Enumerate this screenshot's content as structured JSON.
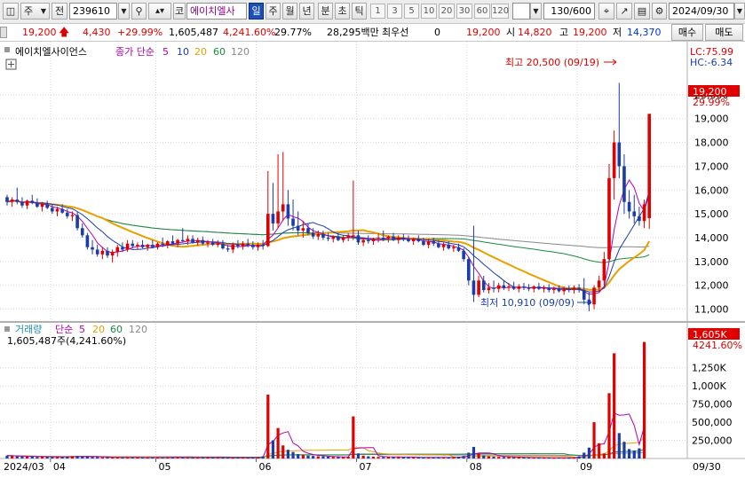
{
  "toolbar": {
    "market_select": "주",
    "prefix_label": "전",
    "code": "239610",
    "market_label": "코",
    "name": "에이치엘사",
    "periods": [
      "일",
      "주",
      "월",
      "년",
      "분",
      "초",
      "틱"
    ],
    "active_period": "일",
    "numbers": [
      "1",
      "3",
      "5",
      "10",
      "20",
      "30",
      "60",
      "120"
    ],
    "count": "130/600",
    "date": "2024/09/30"
  },
  "quote": {
    "price": "19,200",
    "change": "4,430",
    "change_pct": "+29.99%",
    "volume": "1,605,487",
    "volume_ratio": "4,241.60%",
    "turnover": "29.77%",
    "amount": "28,295백만",
    "pref_label": "최우선",
    "pref_value": "0",
    "ask": "19,200",
    "open_label": "시",
    "open": "14,820",
    "high_label": "고",
    "high": "19,200",
    "low_label": "저",
    "low": "14,370",
    "buy_button": "매수",
    "sell_button": "매도"
  },
  "price_panel": {
    "name": "에이치엘사이언스",
    "ma_label": "종가 단순",
    "ma_periods": [
      "5",
      "10",
      "20",
      "60",
      "120"
    ],
    "ma_colors": [
      "#b000b0",
      "#1c3ca8",
      "#e8a000",
      "#1a8a3c",
      "#888888"
    ],
    "lc": "LC:75.99",
    "hc": "HC:-6.34",
    "current_tag": "19,200",
    "current_pct": "29.99%",
    "high_annotation": "최고 20,500 (09/19)",
    "low_annotation": "최저 10,910 (09/09)"
  },
  "volume_panel": {
    "label": "거래량",
    "ma_label": "단순",
    "ma_periods": [
      "5",
      "20",
      "60",
      "120"
    ],
    "volume_text": "1,605,487주(4,241.60%)",
    "current_tag": "1,605K",
    "current_pct": "4241.60%"
  },
  "x_labels": [
    "2024/03",
    "04",
    "05",
    "06",
    "07",
    "08",
    "09",
    "09/30"
  ],
  "chart_data": {
    "type": "candlestick",
    "title": "에이치엘사이언스",
    "price_ylim": [
      10500,
      21000
    ],
    "price_ticks": [
      11000,
      12000,
      13000,
      14000,
      15000,
      16000,
      17000,
      18000,
      19000,
      20000
    ],
    "volume_ticks": [
      250000,
      500000,
      750000,
      1000000,
      1250000
    ],
    "volume_tick_labels": [
      "250,000",
      "500,000",
      "750,000",
      "1,000K",
      "1,250K"
    ],
    "volume_ylim": [
      0,
      1650000
    ],
    "months": [
      {
        "label": "2024/03",
        "index": 0
      },
      {
        "label": "04",
        "index": 9
      },
      {
        "label": "05",
        "index": 30
      },
      {
        "label": "06",
        "index": 50
      },
      {
        "label": "07",
        "index": 70
      },
      {
        "label": "08",
        "index": 92
      },
      {
        "label": "09",
        "index": 114
      }
    ],
    "ohlc": [
      [
        15700,
        15800,
        15350,
        15500
      ],
      [
        15500,
        15700,
        15300,
        15600
      ],
      [
        15600,
        16100,
        15400,
        15500
      ],
      [
        15500,
        15700,
        15250,
        15350
      ],
      [
        15350,
        15600,
        15200,
        15550
      ],
      [
        15550,
        15800,
        15400,
        15450
      ],
      [
        15450,
        15650,
        15250,
        15300
      ],
      [
        15300,
        15500,
        15100,
        15400
      ],
      [
        15400,
        15550,
        15200,
        15250
      ],
      [
        15250,
        15400,
        15000,
        15100
      ],
      [
        15100,
        15300,
        14900,
        15200
      ],
      [
        15200,
        15400,
        15000,
        15050
      ],
      [
        15050,
        15200,
        14800,
        14900
      ],
      [
        14900,
        15100,
        14700,
        14950
      ],
      [
        14950,
        15100,
        14300,
        14400
      ],
      [
        14400,
        14600,
        14000,
        14100
      ],
      [
        14100,
        14200,
        13500,
        13600
      ],
      [
        13600,
        13900,
        13300,
        13500
      ],
      [
        13500,
        13700,
        13200,
        13300
      ],
      [
        13300,
        13600,
        13100,
        13450
      ],
      [
        13450,
        13600,
        13150,
        13250
      ],
      [
        13250,
        13500,
        12950,
        13400
      ],
      [
        13400,
        13700,
        13200,
        13600
      ],
      [
        13600,
        13800,
        13400,
        13500
      ],
      [
        13500,
        13900,
        13400,
        13750
      ],
      [
        13750,
        13900,
        13550,
        13650
      ],
      [
        13650,
        13800,
        13500,
        13700
      ],
      [
        13700,
        13900,
        13550,
        13600
      ],
      [
        13600,
        13750,
        13450,
        13700
      ],
      [
        13700,
        13900,
        13550,
        13600
      ],
      [
        13600,
        13800,
        13500,
        13750
      ],
      [
        13750,
        14000,
        13600,
        13700
      ],
      [
        13700,
        13900,
        13550,
        13850
      ],
      [
        13850,
        14100,
        13700,
        13750
      ],
      [
        13750,
        13950,
        13600,
        13900
      ],
      [
        13900,
        14400,
        13800,
        13850
      ],
      [
        13850,
        14100,
        13700,
        13950
      ],
      [
        13950,
        14100,
        13750,
        13800
      ],
      [
        13800,
        14000,
        13650,
        13900
      ],
      [
        13900,
        14050,
        13700,
        13750
      ],
      [
        13750,
        13900,
        13600,
        13800
      ],
      [
        13800,
        13950,
        13650,
        13700
      ],
      [
        13700,
        13900,
        13600,
        13750
      ],
      [
        13750,
        13900,
        13500,
        13550
      ],
      [
        13550,
        13700,
        13400,
        13500
      ],
      [
        13500,
        13800,
        13350,
        13700
      ],
      [
        13700,
        13900,
        13550,
        13650
      ],
      [
        13650,
        13850,
        13500,
        13750
      ],
      [
        13750,
        13950,
        13600,
        13700
      ],
      [
        13700,
        13850,
        13500,
        13600
      ],
      [
        13600,
        13800,
        13450,
        13700
      ],
      [
        13700,
        13900,
        13500,
        13650
      ],
      [
        13650,
        16800,
        13600,
        15000
      ],
      [
        15000,
        16300,
        14300,
        14600
      ],
      [
        14600,
        17500,
        14400,
        15100
      ],
      [
        15100,
        17600,
        14700,
        15400
      ],
      [
        15400,
        16000,
        14500,
        14800
      ],
      [
        14800,
        15600,
        14300,
        14500
      ],
      [
        14500,
        15100,
        14100,
        14300
      ],
      [
        14300,
        14700,
        14000,
        14400
      ],
      [
        14400,
        14600,
        14100,
        14200
      ],
      [
        14200,
        14400,
        13950,
        14050
      ],
      [
        14050,
        14300,
        13900,
        14150
      ],
      [
        14150,
        14300,
        13900,
        14000
      ],
      [
        14000,
        14200,
        13850,
        13950
      ],
      [
        13950,
        14100,
        13800,
        14050
      ],
      [
        14050,
        14200,
        13850,
        13900
      ],
      [
        13900,
        14100,
        13800,
        14000
      ],
      [
        14000,
        14200,
        13850,
        14100
      ],
      [
        14100,
        16400,
        13900,
        14100
      ],
      [
        14100,
        14300,
        13700,
        13800
      ],
      [
        13800,
        14000,
        13650,
        13900
      ],
      [
        13900,
        14100,
        13750,
        13850
      ],
      [
        13850,
        14000,
        13700,
        13950
      ],
      [
        13950,
        14200,
        13800,
        14000
      ],
      [
        14000,
        14300,
        13850,
        13950
      ],
      [
        13950,
        14100,
        13800,
        14050
      ],
      [
        14050,
        14200,
        13850,
        13900
      ],
      [
        13900,
        14100,
        13750,
        14000
      ],
      [
        14000,
        14150,
        13850,
        13950
      ],
      [
        13950,
        14100,
        13800,
        13850
      ],
      [
        13850,
        14000,
        13700,
        13950
      ],
      [
        13950,
        14100,
        13800,
        13850
      ],
      [
        13850,
        14000,
        13650,
        13700
      ],
      [
        13700,
        13950,
        13550,
        13850
      ],
      [
        13850,
        14000,
        13650,
        13750
      ],
      [
        13750,
        13900,
        13550,
        13600
      ],
      [
        13600,
        13800,
        13450,
        13700
      ],
      [
        13700,
        13850,
        13500,
        13550
      ],
      [
        13550,
        13700,
        13400,
        13600
      ],
      [
        13600,
        13750,
        13400,
        13450
      ],
      [
        13450,
        13550,
        13000,
        13100
      ],
      [
        13100,
        13200,
        12000,
        12200
      ],
      [
        12200,
        14500,
        11300,
        11600
      ],
      [
        11600,
        12400,
        11500,
        12200
      ],
      [
        12200,
        12400,
        11700,
        11800
      ],
      [
        11800,
        12100,
        11650,
        11900
      ],
      [
        11900,
        12200,
        11700,
        11850
      ],
      [
        11850,
        12100,
        11700,
        12000
      ],
      [
        12000,
        12200,
        11800,
        11900
      ],
      [
        11900,
        12100,
        11750,
        11950
      ],
      [
        11950,
        12150,
        11800,
        11850
      ],
      [
        11850,
        12050,
        11700,
        11950
      ],
      [
        11950,
        12100,
        11800,
        11900
      ],
      [
        11900,
        12050,
        11750,
        11850
      ],
      [
        11850,
        12000,
        11700,
        11950
      ],
      [
        11950,
        12100,
        11800,
        11850
      ],
      [
        11850,
        12000,
        11700,
        11900
      ],
      [
        11900,
        12050,
        11700,
        11800
      ],
      [
        11800,
        11950,
        11650,
        11850
      ],
      [
        11850,
        12000,
        11700,
        11750
      ],
      [
        11750,
        11950,
        11600,
        11850
      ],
      [
        11850,
        12000,
        11700,
        11800
      ],
      [
        11800,
        12000,
        11650,
        11900
      ],
      [
        11900,
        12050,
        11700,
        11800
      ],
      [
        11800,
        12300,
        11200,
        11400
      ],
      [
        11400,
        11700,
        10910,
        11200
      ],
      [
        11200,
        12000,
        11000,
        11900
      ],
      [
        11900,
        12400,
        11700,
        12200
      ],
      [
        12200,
        13400,
        12000,
        13100
      ],
      [
        13100,
        17100,
        13000,
        16500
      ],
      [
        16500,
        18500,
        15600,
        18000
      ],
      [
        18000,
        20500,
        16500,
        17000
      ],
      [
        17000,
        17500,
        15000,
        15500
      ],
      [
        15500,
        16000,
        14800,
        15100
      ],
      [
        15100,
        15800,
        14600,
        14900
      ],
      [
        14900,
        15300,
        14500,
        14700
      ],
      [
        14700,
        15600,
        14400,
        15400
      ],
      [
        14820,
        19200,
        14370,
        19200
      ]
    ],
    "volume": [
      40000,
      35000,
      30000,
      28000,
      25000,
      30000,
      22000,
      25000,
      20000,
      22000,
      18000,
      20000,
      25000,
      30000,
      35000,
      25000,
      30000,
      20000,
      18000,
      15000,
      16000,
      14000,
      18000,
      15000,
      12000,
      14000,
      13000,
      15000,
      12000,
      14000,
      13000,
      15000,
      14000,
      16000,
      13000,
      15000,
      12000,
      14000,
      13000,
      15000,
      12000,
      13000,
      14000,
      12000,
      13000,
      11000,
      12000,
      13000,
      11000,
      12000,
      13000,
      30000,
      880000,
      250000,
      420000,
      180000,
      120000,
      90000,
      60000,
      50000,
      40000,
      35000,
      30000,
      28000,
      25000,
      22000,
      20000,
      18000,
      25000,
      580000,
      70000,
      40000,
      30000,
      25000,
      22000,
      20000,
      18000,
      22000,
      20000,
      18000,
      17000,
      15000,
      14000,
      16000,
      15000,
      14000,
      13000,
      15000,
      14000,
      20000,
      25000,
      35000,
      80000,
      160000,
      70000,
      40000,
      30000,
      25000,
      22000,
      20000,
      18000,
      16000,
      15000,
      14000,
      13000,
      12000,
      11000,
      12000,
      11000,
      10000,
      12000,
      11000,
      10000,
      12000,
      30000,
      80000,
      150000,
      500000,
      210000,
      70000,
      900000,
      1450000,
      350000,
      230000,
      130000,
      110000,
      140000,
      1605487
    ]
  }
}
